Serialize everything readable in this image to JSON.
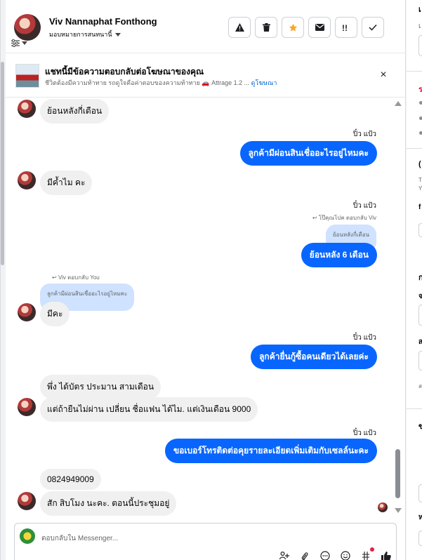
{
  "header": {
    "name": "Viv Nannaphat Fonthong",
    "assignment": "มอบหมายการสนทนานี้",
    "actions": [
      "warning-icon",
      "trash-icon",
      "star-icon",
      "envelope-icon",
      "important-icon",
      "check-icon"
    ]
  },
  "ad_banner": {
    "title": "แชทนี้มีข้อความตอบกลับต่อโฆษณาของคุณ",
    "subtitle": "ชีวิตต้องมีความท้าทาย รถดูใจคือค่าตอบของความท้าทาย 🚗 Attrage 1.2 ...",
    "link": "ดูโฆษณา",
    "close": "×"
  },
  "messages": {
    "m1": "ย้อนหลังกี่เดือน",
    "s2": "ปิ๋ว แป้ว",
    "m2": "ลูกค้ามีผ่อนสินเชื่ออะไรอยู่ไหมคะ",
    "m3": "มีค้ำไม คะ",
    "s4": "ปิ๋ว แป้ว",
    "r4": "โป๊คุณโปค ตอบกลับ Viv",
    "q4": "ย้อนหลังกี่เดือน",
    "m4": "ย้อนหลัง 6 เดือน",
    "r5": "Viv ตอบกลับ You",
    "q5": "ลูกค้ามีผ่อนสินเชื่ออะไรอยู่ไหมคะ",
    "m5": "มีคะ",
    "s6": "ปิ๋ว แป้ว",
    "m6": "ลูกค้ายื่นกู้ซื้อคนเดียวได้เลยค่ะ",
    "m7": "พึ่ง ได้บัตร ประมาน สามเดือน",
    "m8": "แต่ถ้ายืนไม่ผ่าน เปลี่ยน ชื่อแฟน ได้ไม. แต่เงินเดือน 9000",
    "s9": "ปิ๋ว แป้ว",
    "m9": "ขอเบอร์โทรติดต่อคุยรายละเอียดเพิ่มเติมกับเซลล์นะคะ",
    "m10": "0824949009",
    "m11": "สัก สิบโมง นะคะ. ตอนนี้ประชุมอยู่"
  },
  "composer": {
    "placeholder": "ตอบกลับใน Messenger...",
    "tools": [
      "add-people-icon",
      "attachment-icon",
      "more-icon",
      "emoji-icon",
      "gif-icon",
      "thumbs-up-icon"
    ]
  },
  "right_column": {
    "frag1": "เ",
    "frag2": "เ",
    "frag3": "ร",
    "frag4": "(",
    "frag5": "T",
    "frag6": "Y",
    "frag7": "f",
    "frag8": "ก",
    "frag9": "จ",
    "frag10": "ส",
    "frag11": "ส",
    "frag12": "ข",
    "frag13": "ห"
  }
}
